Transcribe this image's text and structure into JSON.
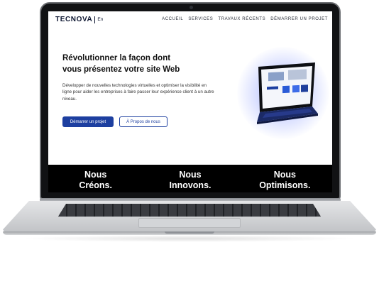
{
  "site": {
    "logo": "TECNOVA",
    "language": "En",
    "nav": [
      "ACCUEIL",
      "SERVICES",
      "TRAVAUX RÉCENTS",
      "DÉMARRER UN PROJET"
    ]
  },
  "hero": {
    "title_line1": "Révolutionner la façon dont",
    "title_line2": "vous présentez votre site Web",
    "description": "Développer de nouvelles technologies virtuelles et optimiser la visibilité en ligne pour aider les entreprises à faire passer leur expérience client à un autre niveau.",
    "primary_button": "Démarrer un projet",
    "secondary_button": "À Propos de nous"
  },
  "slogans": [
    {
      "line1": "Nous",
      "line2": "Créons."
    },
    {
      "line1": "Nous",
      "line2": "Innovons."
    },
    {
      "line1": "Nous",
      "line2": "Optimisons."
    }
  ],
  "colors": {
    "brand": "#1d3fa0",
    "band": "#000000",
    "glow": "#5a6eff"
  }
}
